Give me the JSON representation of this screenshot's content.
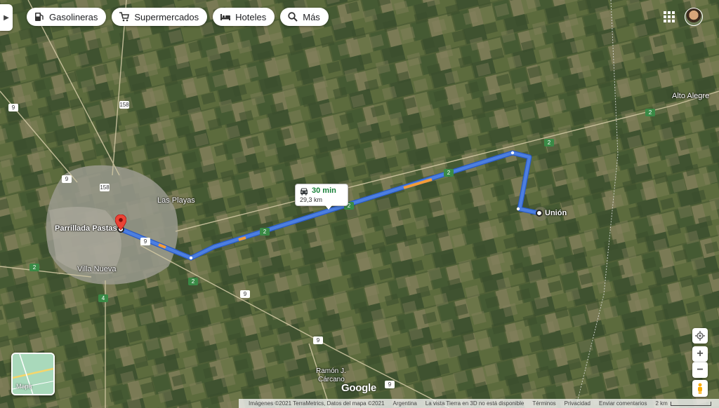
{
  "chips": [
    {
      "label": "Gasolineras",
      "icon": "gas-station-icon"
    },
    {
      "label": "Supermercados",
      "icon": "cart-icon"
    },
    {
      "label": "Hoteles",
      "icon": "bed-icon"
    },
    {
      "label": "Más",
      "icon": "search-icon"
    }
  ],
  "places": {
    "origin": "Parrillada Pastas",
    "destination": "Unión",
    "towns": [
      "Las Playas",
      "Villa Nueva",
      "Alto Alegre",
      "Ramón J.",
      "Cárcano"
    ]
  },
  "route": {
    "duration": "30 min",
    "distance": "29,3 km"
  },
  "road_shields": {
    "r158": "158",
    "r9": "9",
    "r2": "2",
    "r4": "4"
  },
  "map_type": {
    "label": "Mapa"
  },
  "controls": {
    "zoom_in": "+",
    "zoom_out": "−"
  },
  "branding": "Google",
  "footer": {
    "imagery": "Imágenes ©2021 TerraMetrics, Datos del mapa ©2021",
    "country": "Argentina",
    "notice": "La vista Tierra en 3D no está disponible",
    "terms": "Términos",
    "privacy": "Privacidad",
    "feedback": "Enviar comentarios",
    "scale": "2 km"
  },
  "colors": {
    "route": "#4c7fe0",
    "route_outline": "#2a5bc5",
    "time": "#188038",
    "pin": "#ea4335"
  }
}
